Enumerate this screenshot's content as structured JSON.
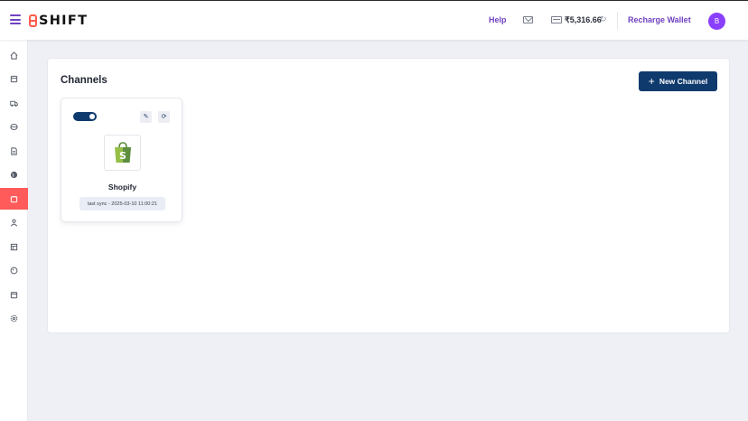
{
  "app": {
    "brand": "SHIFT"
  },
  "header": {
    "help_label": "Help",
    "wallet_balance": "₹5,316.66",
    "recharge_label": "Recharge Wallet",
    "avatar_initial": "B"
  },
  "sidebar": {
    "items": [
      {
        "icon": "home-icon",
        "active": false
      },
      {
        "icon": "orders-icon",
        "active": false
      },
      {
        "icon": "shipping-truck-icon",
        "active": false
      },
      {
        "icon": "package-icon",
        "active": false
      },
      {
        "icon": "document-icon",
        "active": false
      },
      {
        "icon": "globe-icon",
        "active": false
      },
      {
        "icon": "channels-icon",
        "active": true
      },
      {
        "icon": "user-icon",
        "active": false
      },
      {
        "icon": "store-icon",
        "active": false
      },
      {
        "icon": "tag-icon",
        "active": false
      },
      {
        "icon": "calendar-icon",
        "active": false
      },
      {
        "icon": "settings-icon",
        "active": false
      }
    ]
  },
  "main": {
    "title": "Channels",
    "new_channel_label": "New Channel",
    "channels": [
      {
        "name": "Shopify",
        "enabled": true,
        "last_sync": "last sync - 2025-03-10 11:00:21"
      }
    ]
  },
  "colors": {
    "brand_accent": "#ff5b49",
    "link_purple": "#6f42c1",
    "primary_navy": "#0f3a6e",
    "sidebar_active": "#ff5b5b",
    "avatar": "#8a3ffc",
    "shopify_green": "#5e8e3e"
  }
}
